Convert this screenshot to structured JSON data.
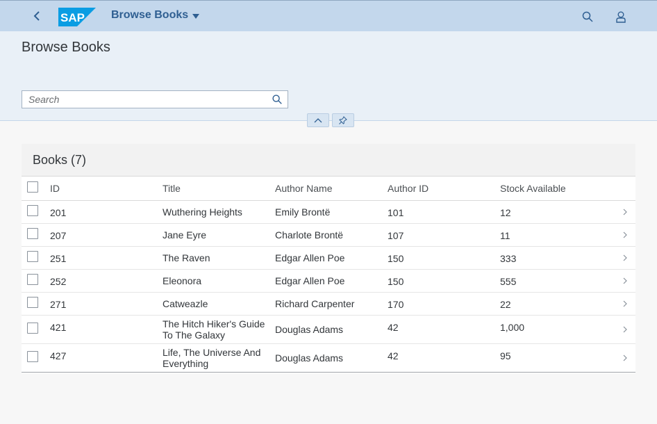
{
  "shell": {
    "app_title": "Browse Books",
    "logo_text": "SAP"
  },
  "header": {
    "page_title": "Browse Books",
    "search_placeholder": "Search"
  },
  "table": {
    "title": "Books (7)",
    "columns": [
      "ID",
      "Title",
      "Author Name",
      "Author ID",
      "Stock Available"
    ],
    "rows": [
      {
        "id": "201",
        "title": "Wuthering Heights",
        "author": "Emily Brontë",
        "author_id": "101",
        "stock": "12"
      },
      {
        "id": "207",
        "title": "Jane Eyre",
        "author": "Charlote Brontë",
        "author_id": "107",
        "stock": "11"
      },
      {
        "id": "251",
        "title": "The Raven",
        "author": "Edgar Allen Poe",
        "author_id": "150",
        "stock": "333"
      },
      {
        "id": "252",
        "title": "Eleonora",
        "author": "Edgar Allen Poe",
        "author_id": "150",
        "stock": "555"
      },
      {
        "id": "271",
        "title": "Catweazle",
        "author": "Richard Carpenter",
        "author_id": "170",
        "stock": "22"
      },
      {
        "id": "421",
        "title": "The Hitch Hiker's Guide To The Galaxy",
        "author": "Douglas Adams",
        "author_id": "42",
        "stock": "1,000"
      },
      {
        "id": "427",
        "title": "Life, The Universe And Everything",
        "author": "Douglas Adams",
        "author_id": "42",
        "stock": "95"
      }
    ]
  },
  "colors": {
    "shell_bg": "#c3d7ec",
    "header_bg": "#e9f0f7",
    "accent": "#2f5f92",
    "logo_blue": "#0a9de3"
  }
}
